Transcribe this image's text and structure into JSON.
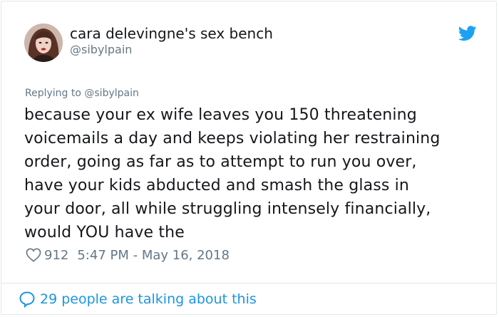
{
  "author": {
    "display_name": "cara delevingne's sex bench",
    "handle": "@sibylpain",
    "avatar_icon": "profile-photo"
  },
  "brand": {
    "icon": "twitter-bird-icon",
    "color": "#1da1f2"
  },
  "reply": {
    "prefix": "Replying to",
    "mention": "@sibylpain"
  },
  "tweet": {
    "lines": [
      "because your ex wife leaves you 150 threatening",
      "voicemails a day and keeps violating her restraining",
      "order, going as far as to attempt to run you over,",
      "have your kids abducted and smash the glass in",
      "your door, all while struggling intensely financially,",
      "would YOU have the"
    ]
  },
  "meta": {
    "like_icon": "heart-icon",
    "likes": "912",
    "timestamp": "5:47 PM - May 16, 2018"
  },
  "conversation": {
    "icon": "speech-bubble-icon",
    "label": "29 people are talking about this",
    "color": "#1b95e0"
  },
  "colors": {
    "text_primary": "#14171a",
    "text_secondary": "#657786",
    "border": "#e1e8ed"
  }
}
